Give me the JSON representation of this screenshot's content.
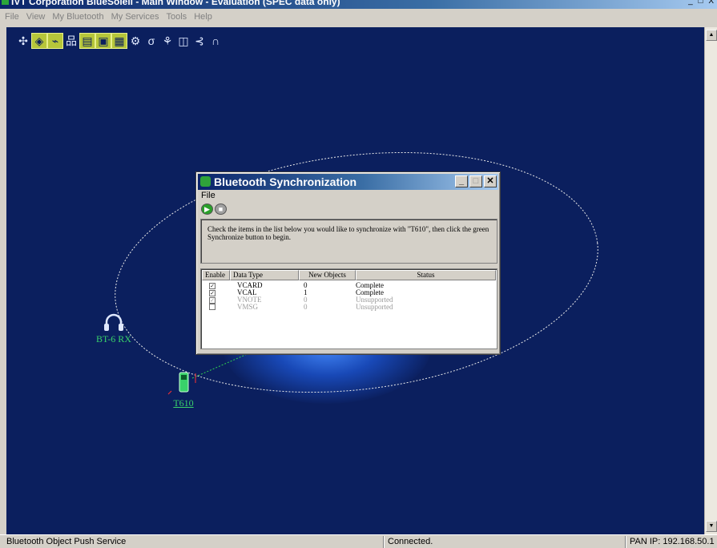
{
  "window": {
    "title": "IVT Corporation BlueSoleil - Main Window - Evaluation (SPEC data only)",
    "controls": "_ □ X"
  },
  "menu": [
    "File",
    "View",
    "My Bluetooth",
    "My Services",
    "Tools",
    "Help"
  ],
  "toolbar": {
    "icons": [
      {
        "name": "network-hub-icon",
        "glyph": "✣",
        "active": false
      },
      {
        "name": "service-icon",
        "glyph": "◈",
        "active": true
      },
      {
        "name": "modem-icon",
        "glyph": "⌁",
        "active": true
      },
      {
        "name": "lan-icon",
        "glyph": "品",
        "active": false
      },
      {
        "name": "file-icon",
        "glyph": "▤",
        "active": true
      },
      {
        "name": "pim-sync-icon",
        "glyph": "▣",
        "active": true
      },
      {
        "name": "printer-icon",
        "glyph": "▦",
        "active": true
      },
      {
        "name": "fax-icon",
        "glyph": "⚙",
        "active": false
      },
      {
        "name": "pen-icon",
        "glyph": "σ",
        "active": false
      },
      {
        "name": "hid-icon",
        "glyph": "⚘",
        "active": false
      },
      {
        "name": "camera-icon",
        "glyph": "◫",
        "active": false
      },
      {
        "name": "audio-icon",
        "glyph": "⊰",
        "active": false
      },
      {
        "name": "headset-icon",
        "glyph": "∩",
        "active": false
      }
    ]
  },
  "devices": {
    "headset": {
      "label": "BT-6 RX"
    },
    "phone": {
      "label": "T610"
    }
  },
  "dialog": {
    "title": "Bluetooth Synchronization",
    "menu_file": "File",
    "instructions": "Check the items in the list below you would like to synchronize with \"T610\", then click the green Synchronize button to begin.",
    "columns": [
      "Enable",
      "Data Type",
      "New Objects",
      "Status"
    ],
    "rows": [
      {
        "checked": true,
        "type": "VCARD",
        "new": "0",
        "status": "Complete",
        "disabled": false
      },
      {
        "checked": true,
        "type": "VCAL",
        "new": "1",
        "status": "Complete",
        "disabled": false
      },
      {
        "checked": true,
        "type": "VNOTE",
        "new": "0",
        "status": "Unsupported",
        "disabled": true
      },
      {
        "checked": false,
        "type": "VMSG",
        "new": "0",
        "status": "Unsupported",
        "disabled": true
      }
    ]
  },
  "status": {
    "left": "Bluetooth Object Push Service",
    "middle": "Connected.",
    "right": "PAN IP: 192.168.50.1"
  },
  "colors": {
    "canvas": "#0b1f5e",
    "device_label": "#39d16a",
    "title_gradient_start": "#0a246a"
  }
}
